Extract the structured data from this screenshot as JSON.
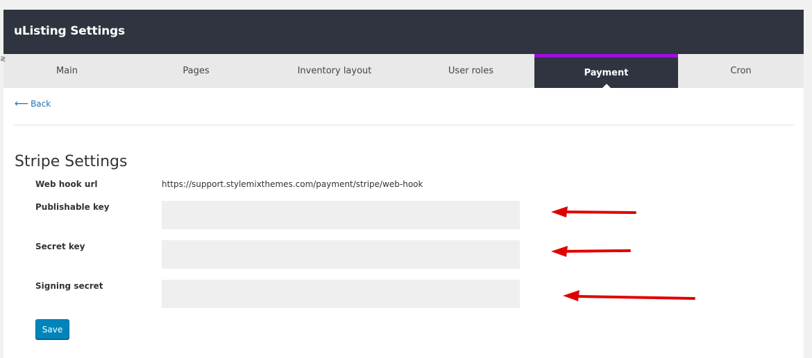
{
  "header": {
    "title": "uListing Settings"
  },
  "tabs": [
    {
      "label": "Main",
      "active": false
    },
    {
      "label": "Pages",
      "active": false
    },
    {
      "label": "Inventory layout",
      "active": false
    },
    {
      "label": "User roles",
      "active": false
    },
    {
      "label": "Payment",
      "active": true
    },
    {
      "label": "Cron",
      "active": false
    }
  ],
  "colors": {
    "header_bg": "#2f3440",
    "active_tab_accent": "#a10ee0",
    "link": "#2271b1",
    "save_button": "#0085ba",
    "annotation_arrow": "#e00000"
  },
  "back": {
    "icon": "arrow-left-icon",
    "label": "Back"
  },
  "stripe": {
    "title": "Stripe Settings",
    "webhook": {
      "label": "Web hook url",
      "value": "https://support.stylemixthemes.com/payment/stripe/web-hook"
    },
    "publishable_key": {
      "label": "Publishable key",
      "value": ""
    },
    "secret_key": {
      "label": "Secret key",
      "value": ""
    },
    "signing_secret": {
      "label": "Signing secret",
      "value": ""
    },
    "save_label": "Save"
  }
}
